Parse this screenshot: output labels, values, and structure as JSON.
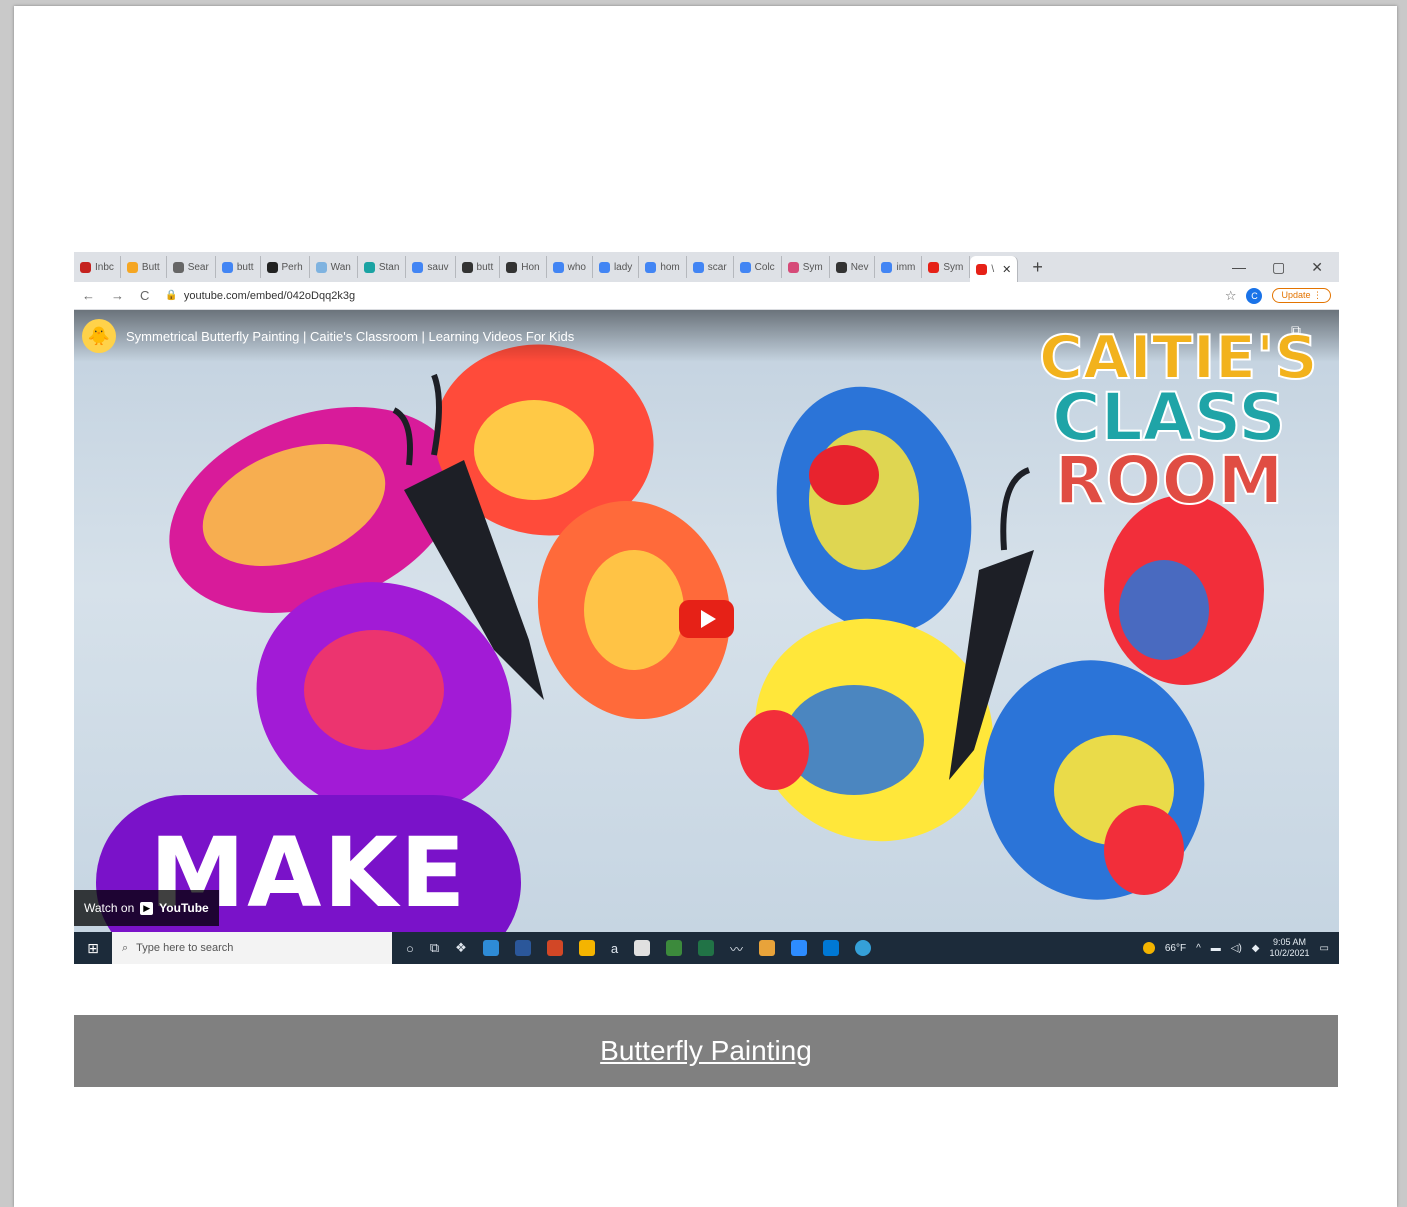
{
  "browser": {
    "tabs": [
      {
        "label": "Inbc",
        "color": "#c5221f"
      },
      {
        "label": "Butt",
        "color": "#f5a623"
      },
      {
        "label": "Sear",
        "color": "#666666"
      },
      {
        "label": "butt",
        "color": "#4285f4"
      },
      {
        "label": "Perh",
        "color": "#222222"
      },
      {
        "label": "Wan",
        "color": "#7fb3e0"
      },
      {
        "label": "Stan",
        "color": "#1aa3a3"
      },
      {
        "label": "sauv",
        "color": "#4285f4"
      },
      {
        "label": "butt",
        "color": "#333333"
      },
      {
        "label": "Hon",
        "color": "#333333"
      },
      {
        "label": "who",
        "color": "#4285f4"
      },
      {
        "label": "lady",
        "color": "#4285f4"
      },
      {
        "label": "hom",
        "color": "#4285f4"
      },
      {
        "label": "scar",
        "color": "#4285f4"
      },
      {
        "label": "Colc",
        "color": "#4285f4"
      },
      {
        "label": "Sym",
        "color": "#d64a78"
      },
      {
        "label": "Nev",
        "color": "#333333"
      },
      {
        "label": "imm",
        "color": "#4285f4"
      },
      {
        "label": "Sym",
        "color": "#e62117"
      },
      {
        "label": "\\",
        "color": "#e62117",
        "active": true
      }
    ],
    "new_tab": "+",
    "window_controls": {
      "minimize": "—",
      "maximize": "▢",
      "close": "✕"
    },
    "nav": {
      "back": "←",
      "forward": "→",
      "reload": "C"
    },
    "url": "youtube.com/embed/042oDqq2k3g",
    "profile_initial": "C",
    "update_label": "Update ⋮"
  },
  "video": {
    "title": "Symmetrical Butterfly Painting | Caitie's Classroom | Learning Videos For Kids",
    "brand": {
      "line1": "CAITIE'S",
      "line2": "CLASS",
      "line3": "ROOM"
    },
    "make_text": "MAKE",
    "watch_on": "Watch on",
    "youtube_word": "YouTube",
    "colors": {
      "play": "#e62117",
      "pill": "#7a12c9"
    }
  },
  "taskbar": {
    "search_placeholder": "Type here to search",
    "weather": "66°F",
    "time": "9:05 AM",
    "date": "10/2/2021"
  },
  "caption": {
    "link_text": "Butterfly Painting"
  }
}
